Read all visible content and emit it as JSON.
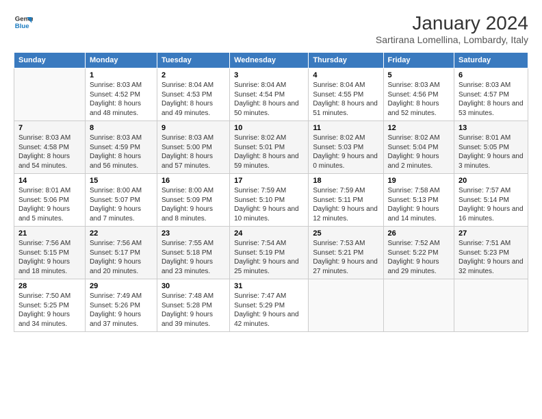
{
  "logo": {
    "line1": "General",
    "line2": "Blue"
  },
  "title": "January 2024",
  "subtitle": "Sartirana Lomellina, Lombardy, Italy",
  "weekdays": [
    "Sunday",
    "Monday",
    "Tuesday",
    "Wednesday",
    "Thursday",
    "Friday",
    "Saturday"
  ],
  "weeks": [
    [
      {
        "day": "",
        "sunrise": "",
        "sunset": "",
        "daylight": ""
      },
      {
        "day": "1",
        "sunrise": "Sunrise: 8:03 AM",
        "sunset": "Sunset: 4:52 PM",
        "daylight": "Daylight: 8 hours and 48 minutes."
      },
      {
        "day": "2",
        "sunrise": "Sunrise: 8:04 AM",
        "sunset": "Sunset: 4:53 PM",
        "daylight": "Daylight: 8 hours and 49 minutes."
      },
      {
        "day": "3",
        "sunrise": "Sunrise: 8:04 AM",
        "sunset": "Sunset: 4:54 PM",
        "daylight": "Daylight: 8 hours and 50 minutes."
      },
      {
        "day": "4",
        "sunrise": "Sunrise: 8:04 AM",
        "sunset": "Sunset: 4:55 PM",
        "daylight": "Daylight: 8 hours and 51 minutes."
      },
      {
        "day": "5",
        "sunrise": "Sunrise: 8:03 AM",
        "sunset": "Sunset: 4:56 PM",
        "daylight": "Daylight: 8 hours and 52 minutes."
      },
      {
        "day": "6",
        "sunrise": "Sunrise: 8:03 AM",
        "sunset": "Sunset: 4:57 PM",
        "daylight": "Daylight: 8 hours and 53 minutes."
      }
    ],
    [
      {
        "day": "7",
        "sunrise": "Sunrise: 8:03 AM",
        "sunset": "Sunset: 4:58 PM",
        "daylight": "Daylight: 8 hours and 54 minutes."
      },
      {
        "day": "8",
        "sunrise": "Sunrise: 8:03 AM",
        "sunset": "Sunset: 4:59 PM",
        "daylight": "Daylight: 8 hours and 56 minutes."
      },
      {
        "day": "9",
        "sunrise": "Sunrise: 8:03 AM",
        "sunset": "Sunset: 5:00 PM",
        "daylight": "Daylight: 8 hours and 57 minutes."
      },
      {
        "day": "10",
        "sunrise": "Sunrise: 8:02 AM",
        "sunset": "Sunset: 5:01 PM",
        "daylight": "Daylight: 8 hours and 59 minutes."
      },
      {
        "day": "11",
        "sunrise": "Sunrise: 8:02 AM",
        "sunset": "Sunset: 5:03 PM",
        "daylight": "Daylight: 9 hours and 0 minutes."
      },
      {
        "day": "12",
        "sunrise": "Sunrise: 8:02 AM",
        "sunset": "Sunset: 5:04 PM",
        "daylight": "Daylight: 9 hours and 2 minutes."
      },
      {
        "day": "13",
        "sunrise": "Sunrise: 8:01 AM",
        "sunset": "Sunset: 5:05 PM",
        "daylight": "Daylight: 9 hours and 3 minutes."
      }
    ],
    [
      {
        "day": "14",
        "sunrise": "Sunrise: 8:01 AM",
        "sunset": "Sunset: 5:06 PM",
        "daylight": "Daylight: 9 hours and 5 minutes."
      },
      {
        "day": "15",
        "sunrise": "Sunrise: 8:00 AM",
        "sunset": "Sunset: 5:07 PM",
        "daylight": "Daylight: 9 hours and 7 minutes."
      },
      {
        "day": "16",
        "sunrise": "Sunrise: 8:00 AM",
        "sunset": "Sunset: 5:09 PM",
        "daylight": "Daylight: 9 hours and 8 minutes."
      },
      {
        "day": "17",
        "sunrise": "Sunrise: 7:59 AM",
        "sunset": "Sunset: 5:10 PM",
        "daylight": "Daylight: 9 hours and 10 minutes."
      },
      {
        "day": "18",
        "sunrise": "Sunrise: 7:59 AM",
        "sunset": "Sunset: 5:11 PM",
        "daylight": "Daylight: 9 hours and 12 minutes."
      },
      {
        "day": "19",
        "sunrise": "Sunrise: 7:58 AM",
        "sunset": "Sunset: 5:13 PM",
        "daylight": "Daylight: 9 hours and 14 minutes."
      },
      {
        "day": "20",
        "sunrise": "Sunrise: 7:57 AM",
        "sunset": "Sunset: 5:14 PM",
        "daylight": "Daylight: 9 hours and 16 minutes."
      }
    ],
    [
      {
        "day": "21",
        "sunrise": "Sunrise: 7:56 AM",
        "sunset": "Sunset: 5:15 PM",
        "daylight": "Daylight: 9 hours and 18 minutes."
      },
      {
        "day": "22",
        "sunrise": "Sunrise: 7:56 AM",
        "sunset": "Sunset: 5:17 PM",
        "daylight": "Daylight: 9 hours and 20 minutes."
      },
      {
        "day": "23",
        "sunrise": "Sunrise: 7:55 AM",
        "sunset": "Sunset: 5:18 PM",
        "daylight": "Daylight: 9 hours and 23 minutes."
      },
      {
        "day": "24",
        "sunrise": "Sunrise: 7:54 AM",
        "sunset": "Sunset: 5:19 PM",
        "daylight": "Daylight: 9 hours and 25 minutes."
      },
      {
        "day": "25",
        "sunrise": "Sunrise: 7:53 AM",
        "sunset": "Sunset: 5:21 PM",
        "daylight": "Daylight: 9 hours and 27 minutes."
      },
      {
        "day": "26",
        "sunrise": "Sunrise: 7:52 AM",
        "sunset": "Sunset: 5:22 PM",
        "daylight": "Daylight: 9 hours and 29 minutes."
      },
      {
        "day": "27",
        "sunrise": "Sunrise: 7:51 AM",
        "sunset": "Sunset: 5:23 PM",
        "daylight": "Daylight: 9 hours and 32 minutes."
      }
    ],
    [
      {
        "day": "28",
        "sunrise": "Sunrise: 7:50 AM",
        "sunset": "Sunset: 5:25 PM",
        "daylight": "Daylight: 9 hours and 34 minutes."
      },
      {
        "day": "29",
        "sunrise": "Sunrise: 7:49 AM",
        "sunset": "Sunset: 5:26 PM",
        "daylight": "Daylight: 9 hours and 37 minutes."
      },
      {
        "day": "30",
        "sunrise": "Sunrise: 7:48 AM",
        "sunset": "Sunset: 5:28 PM",
        "daylight": "Daylight: 9 hours and 39 minutes."
      },
      {
        "day": "31",
        "sunrise": "Sunrise: 7:47 AM",
        "sunset": "Sunset: 5:29 PM",
        "daylight": "Daylight: 9 hours and 42 minutes."
      },
      {
        "day": "",
        "sunrise": "",
        "sunset": "",
        "daylight": ""
      },
      {
        "day": "",
        "sunrise": "",
        "sunset": "",
        "daylight": ""
      },
      {
        "day": "",
        "sunrise": "",
        "sunset": "",
        "daylight": ""
      }
    ]
  ]
}
